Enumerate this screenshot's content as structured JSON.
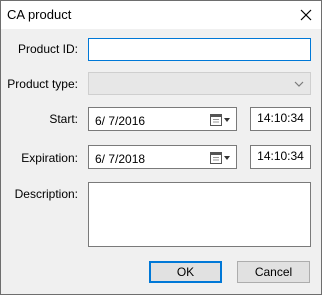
{
  "window": {
    "title": "CA product"
  },
  "fields": {
    "product_id": {
      "label": "Product ID:",
      "value": ""
    },
    "product_type": {
      "label": "Product type:",
      "value": ""
    },
    "start": {
      "label": "Start:",
      "date": "6/ 7/2016",
      "time": "14:10:34"
    },
    "expiration": {
      "label": "Expiration:",
      "date": "6/ 7/2018",
      "time": "14:10:34"
    },
    "description": {
      "label": "Description:",
      "value": ""
    }
  },
  "buttons": {
    "ok": "OK",
    "cancel": "Cancel"
  },
  "icons": {
    "close": "close-icon",
    "dropdown": "chevron-down-icon",
    "calendar": "calendar-icon"
  }
}
